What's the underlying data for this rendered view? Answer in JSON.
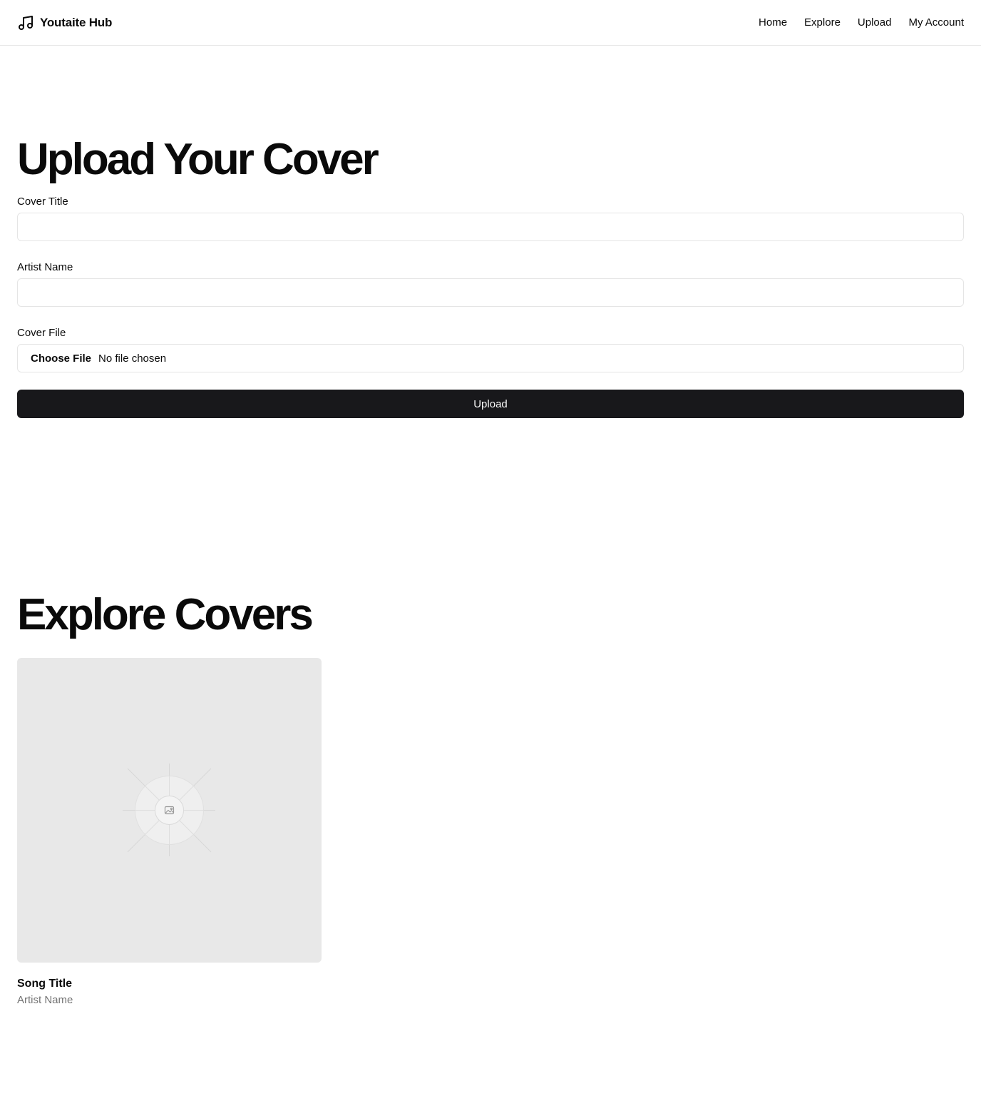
{
  "header": {
    "brand_icon": "music-note-icon",
    "brand_name": "Youtaite Hub",
    "nav": [
      "Home",
      "Explore",
      "Upload",
      "My Account"
    ]
  },
  "upload": {
    "heading": "Upload Your Cover",
    "cover_title_label": "Cover Title",
    "cover_title_value": "",
    "artist_name_label": "Artist Name",
    "artist_name_value": "",
    "cover_file_label": "Cover File",
    "choose_file_label": "Choose File",
    "file_status": "No file chosen",
    "submit_label": "Upload"
  },
  "explore": {
    "heading": "Explore Covers",
    "covers": [
      {
        "image_icon": "image-placeholder-icon",
        "title": "Song Title",
        "artist": "Artist Name"
      }
    ]
  },
  "colors": {
    "primary_button": "#18181b",
    "border": "#e5e5e5",
    "placeholder_bg": "#e8e8e8",
    "muted_text": "#737373"
  }
}
